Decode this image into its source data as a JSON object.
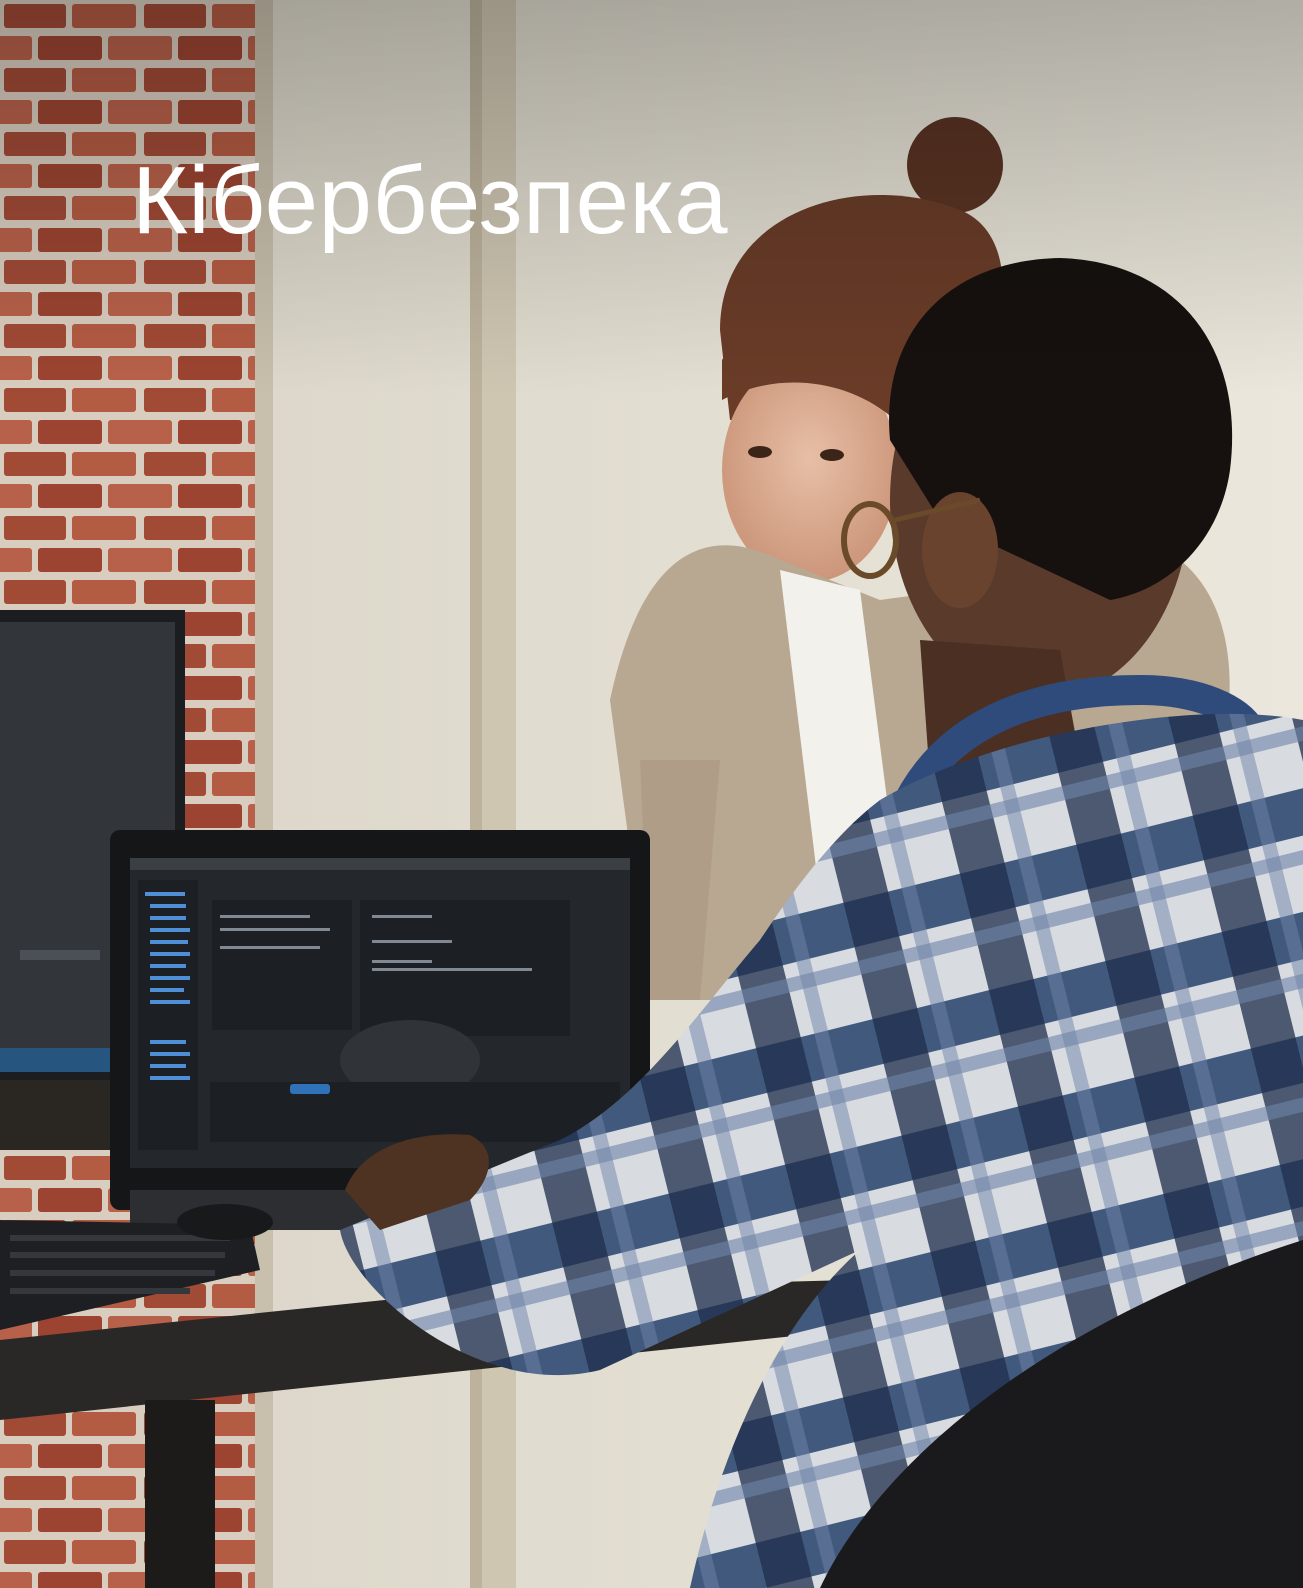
{
  "hero": {
    "title": "Кібербезпека"
  },
  "photo": {
    "subject": "photo-two-people-at-computer"
  }
}
